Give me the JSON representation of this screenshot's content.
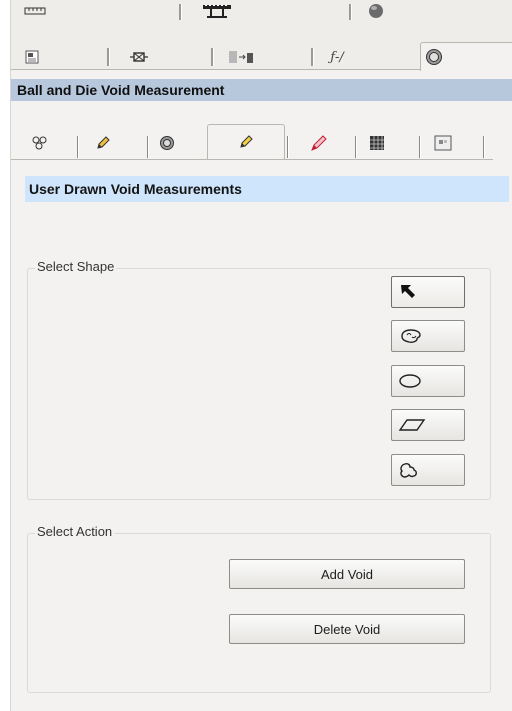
{
  "top_tabs_row1": [
    {
      "icon": "ruler-icon"
    },
    {
      "icon": "film-strip-icon"
    },
    {
      "icon": "sphere-icon"
    }
  ],
  "top_tabs_row2": [
    {
      "icon": "document-icon"
    },
    {
      "icon": "pin-icon"
    },
    {
      "icon": "align-icon"
    },
    {
      "icon": "function-icon",
      "label": "ƒ-/"
    },
    {
      "icon": "target-icon",
      "active": true
    }
  ],
  "section_title": "Ball and Die Void Measurement",
  "sub_tabs": [
    {
      "icon": "circles-icon"
    },
    {
      "icon": "pencil-icon"
    },
    {
      "icon": "ball-icon"
    },
    {
      "icon": "pencil-active-icon",
      "active": true
    },
    {
      "icon": "pencil-red-icon"
    },
    {
      "icon": "grid-icon"
    },
    {
      "icon": "template-icon"
    }
  ],
  "sub_section_title": "User Drawn Void Measurements",
  "select_shape": {
    "label": "Select Shape",
    "shapes": [
      {
        "name": "pointer",
        "icon": "arrow-pointer-icon"
      },
      {
        "name": "freeform-blob",
        "icon": "blob-shape-icon"
      },
      {
        "name": "ellipse",
        "icon": "ellipse-shape-icon"
      },
      {
        "name": "parallelogram",
        "icon": "parallelogram-shape-icon"
      },
      {
        "name": "lasso",
        "icon": "lasso-shape-icon"
      }
    ]
  },
  "select_action": {
    "label": "Select Action",
    "add_label": "Add Void",
    "delete_label": "Delete Void"
  },
  "colors": {
    "section_header_bg": "#b7c8dd",
    "sub_header_bg": "#cfe5fb",
    "panel_bg": "#f3f2f0"
  }
}
